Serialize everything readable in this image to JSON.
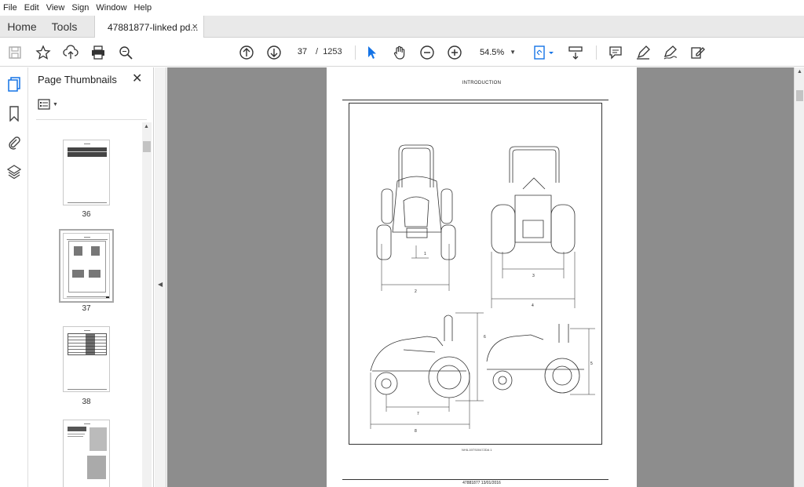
{
  "menu": [
    "File",
    "Edit",
    "View",
    "Sign",
    "Window",
    "Help"
  ],
  "tabs": {
    "home": "Home",
    "tools": "Tools",
    "document": "47881877-linked pd...",
    "close_glyph": "×"
  },
  "toolbar": {
    "current_page": "37",
    "page_separator": "/",
    "total_pages": "1253",
    "zoom": "54.5%",
    "icons": [
      "save-icon",
      "bookmark-star-icon",
      "cloud-upload-icon",
      "print-icon",
      "zoom-search-icon",
      "page-up-icon",
      "page-down-icon",
      "select-cursor-icon",
      "hand-pan-icon",
      "zoom-out-icon",
      "zoom-in-icon",
      "fit-page-icon",
      "scroll-mode-icon",
      "comment-icon",
      "highlight-pen-icon",
      "sign-icon",
      "edit-export-icon"
    ],
    "accent_color": "#1473e6"
  },
  "sidebar_rail": {
    "icons": [
      "page-thumbnails-icon",
      "bookmarks-icon",
      "attachments-icon",
      "layers-icon"
    ]
  },
  "thumbnails_panel": {
    "title": "Page Thumbnails",
    "close_glyph": "✕",
    "pages": [
      {
        "label": "36",
        "selected": false
      },
      {
        "label": "37",
        "selected": true
      },
      {
        "label": "38",
        "selected": false
      },
      {
        "label": "",
        "selected": false
      }
    ]
  },
  "document_page": {
    "header": "INTRODUCTION",
    "image_code": "NHIL15TS00472DA     1",
    "footer": "47881877 13/01/2016",
    "dimension_labels": [
      "1",
      "2",
      "3",
      "4",
      "5",
      "6",
      "7",
      "8"
    ]
  }
}
